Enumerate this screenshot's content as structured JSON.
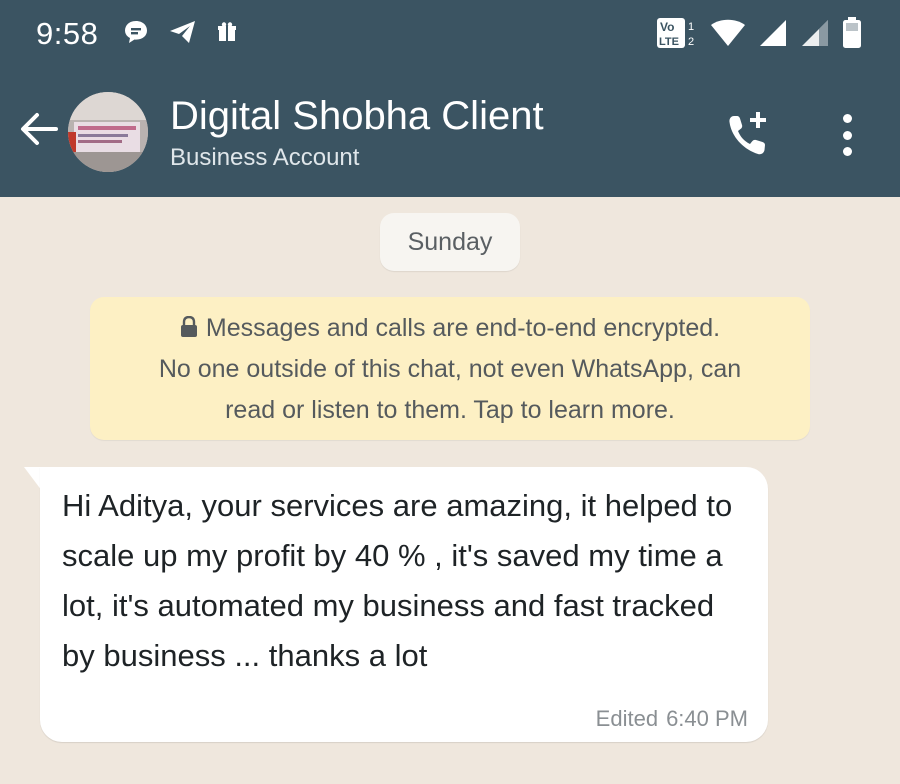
{
  "status_bar": {
    "time": "9:58",
    "left_icons": [
      "chat-bubble-icon",
      "telegram-icon",
      "gift-icon"
    ],
    "network_label_top": "Vo",
    "network_label_bottom": "LTE",
    "sim_number": "1",
    "sim2_number": "2",
    "right_icons": [
      "volte-icon",
      "wifi-icon",
      "signal-icon",
      "signal-2-icon",
      "battery-icon"
    ]
  },
  "header": {
    "contact_name": "Digital Shobha Client",
    "contact_subtitle": "Business Account",
    "bar_color": "#3b5462"
  },
  "chat": {
    "date_label": "Sunday",
    "encryption_notice": [
      "Messages and calls are end-to-end encrypted.",
      "No one outside of this chat, not even WhatsApp, can",
      "read or listen to them. Tap to learn more."
    ],
    "messages": [
      {
        "direction": "incoming",
        "text": "Hi Aditya, your services are amazing, it helped to scale up my profit by 40 % , it's saved my time a lot, it's automated my business and fast tracked by business ... thanks a lot",
        "edited_label": "Edited",
        "time": "6:40 PM"
      }
    ],
    "background_color": "#efe7dd",
    "notice_color": "#fdf0c4"
  }
}
